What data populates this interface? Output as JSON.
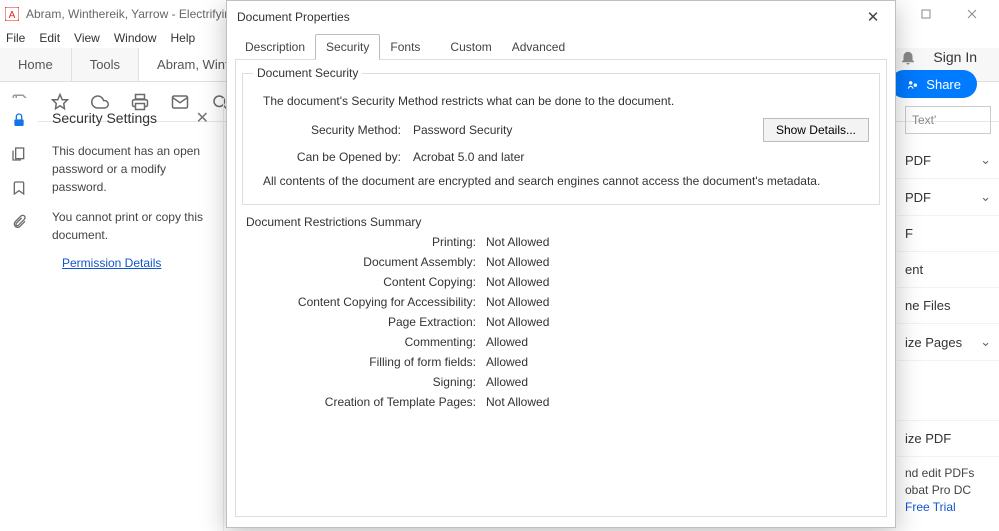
{
  "window": {
    "title": "Abram, Winthereik, Yarrow - Electrifying Anthropol",
    "menus": [
      "File",
      "Edit",
      "View",
      "Window",
      "Help"
    ],
    "tabs": {
      "home": "Home",
      "tools": "Tools",
      "doc": "Abram, Winthereil..."
    },
    "signin": "Sign In",
    "share": "Share"
  },
  "sidepanel": {
    "title": "Security Settings",
    "line1": "This document has an open password or a modify password.",
    "line2": "You cannot print or copy this document.",
    "link": "Permission Details"
  },
  "rightpanel": {
    "search_placeholder": "Text'",
    "items": [
      "PDF",
      "PDF",
      "F",
      "ent",
      "ne Files",
      "ize Pages",
      "",
      "ize PDF"
    ],
    "promo_line1": "nd edit PDFs",
    "promo_line2": "obat Pro DC",
    "promo_link": "Free Trial"
  },
  "dialog": {
    "title": "Document Properties",
    "tabs": [
      "Description",
      "Security",
      "Fonts",
      "Custom",
      "Advanced"
    ],
    "active_tab": 1,
    "group1_legend": "Document Security",
    "note": "The document's Security Method restricts what can be done to the document.",
    "security_method_label": "Security Method:",
    "security_method_value": "Password Security",
    "show_details": "Show Details...",
    "opened_by_label": "Can be Opened by:",
    "opened_by_value": "Acrobat 5.0 and later",
    "encryption_note": "All contents of the document are encrypted and search engines cannot access the document's metadata.",
    "restrictions_head": "Document Restrictions Summary",
    "restrictions": [
      {
        "k": "Printing:",
        "v": "Not Allowed"
      },
      {
        "k": "Document Assembly:",
        "v": "Not Allowed"
      },
      {
        "k": "Content Copying:",
        "v": "Not Allowed"
      },
      {
        "k": "Content Copying for Accessibility:",
        "v": "Not Allowed"
      },
      {
        "k": "Page Extraction:",
        "v": "Not Allowed"
      },
      {
        "k": "Commenting:",
        "v": "Allowed"
      },
      {
        "k": "Filling of form fields:",
        "v": "Allowed"
      },
      {
        "k": "Signing:",
        "v": "Allowed"
      },
      {
        "k": "Creation of Template Pages:",
        "v": "Not Allowed"
      }
    ]
  }
}
